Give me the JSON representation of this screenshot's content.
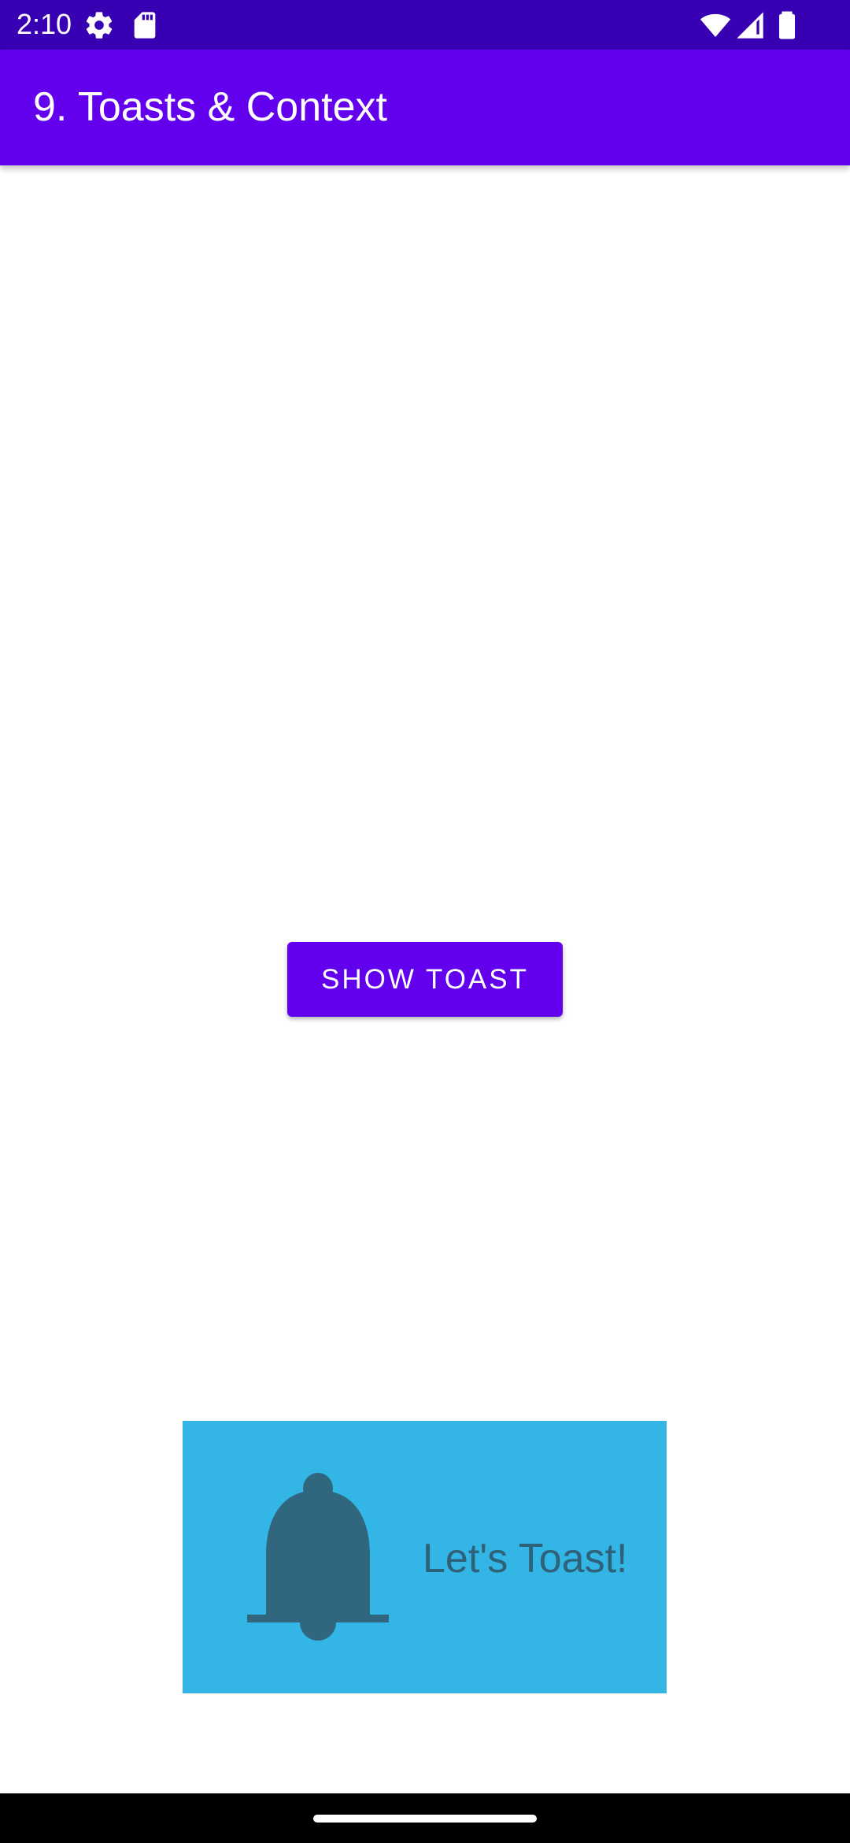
{
  "status_bar": {
    "time": "2:10",
    "background": "#3700b3",
    "icons": [
      "settings-gear-icon",
      "sd-card-icon",
      "wifi-icon",
      "cell-signal-icon",
      "battery-icon"
    ]
  },
  "app_bar": {
    "title": "9. Toasts & Context",
    "background": "#6200ee"
  },
  "main": {
    "show_toast_label": "SHOW TOAST",
    "button_color": "#6200ee"
  },
  "toast": {
    "icon": "bell-icon",
    "text": "Let's Toast!",
    "background": "#33b5e5",
    "foreground": "#2f6179"
  },
  "nav_bar": {
    "background": "#000000"
  }
}
